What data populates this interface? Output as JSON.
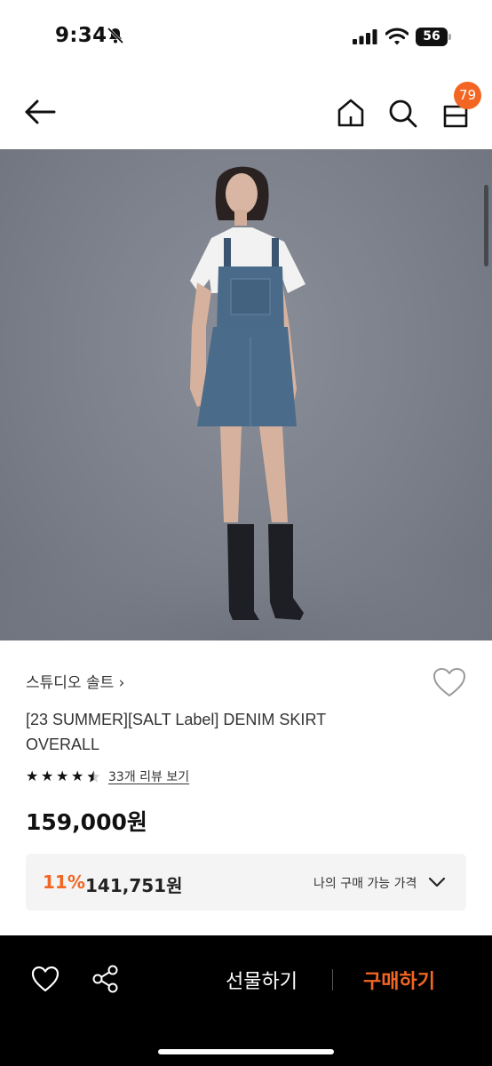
{
  "status_bar": {
    "time": "9:34",
    "battery": "56"
  },
  "header": {
    "cart_count": "79",
    "icons": [
      "back-arrow-icon",
      "home-icon",
      "search-icon",
      "shopping-bag-icon"
    ]
  },
  "product": {
    "brand": "스튜디오 솔트",
    "brand_chevron": "›",
    "title": "[23 SUMMER][SALT Label] DENIM SKIRT OVERALL",
    "rating": 4.5,
    "review_link": "33개 리뷰 보기",
    "price": "159,000원",
    "discount": {
      "rate": "11%",
      "price": "141,751원",
      "label": "나의 구매 가능 가격"
    }
  },
  "bottom_bar": {
    "gift_label": "선물하기",
    "buy_label": "구매하기"
  },
  "colors": {
    "accent": "#f26522",
    "bottom_bar": "#000000",
    "discount_box": "#f4f4f4"
  }
}
